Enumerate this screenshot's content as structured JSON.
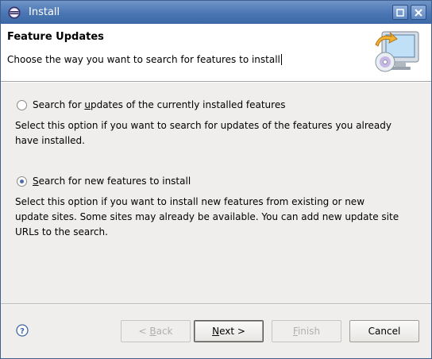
{
  "window": {
    "title": "Install"
  },
  "header": {
    "title": "Feature Updates",
    "description": "Choose the way you want to search for features to install"
  },
  "options": [
    {
      "label_pre": "Search for ",
      "label_mn": "u",
      "label_post": "pdates of the currently installed features",
      "selected": false,
      "description_line1": "Select this option if you want to search for updates of the features you already",
      "description_line2": "have installed."
    },
    {
      "label_pre": "",
      "label_mn": "S",
      "label_post": "earch for new features to install",
      "selected": true,
      "description_line1": "Select this option if you want to install new features from existing or new",
      "description_line2": "update sites. Some sites may already be available. You can add new update site",
      "description_line3": "URLs to the search."
    }
  ],
  "buttons": {
    "back": {
      "pre": "< ",
      "mn": "B",
      "post": "ack"
    },
    "next": {
      "pre": "",
      "mn": "N",
      "post": "ext >"
    },
    "finish": {
      "pre": "",
      "mn": "F",
      "post": "inish"
    },
    "cancel": "Cancel"
  },
  "icons": {
    "app": "eclipse-icon",
    "help": "help-icon",
    "header": "update-wizard-icon"
  },
  "colors": {
    "titlebar": "#4b76b4",
    "selected_radio": "#4b6fa8"
  }
}
